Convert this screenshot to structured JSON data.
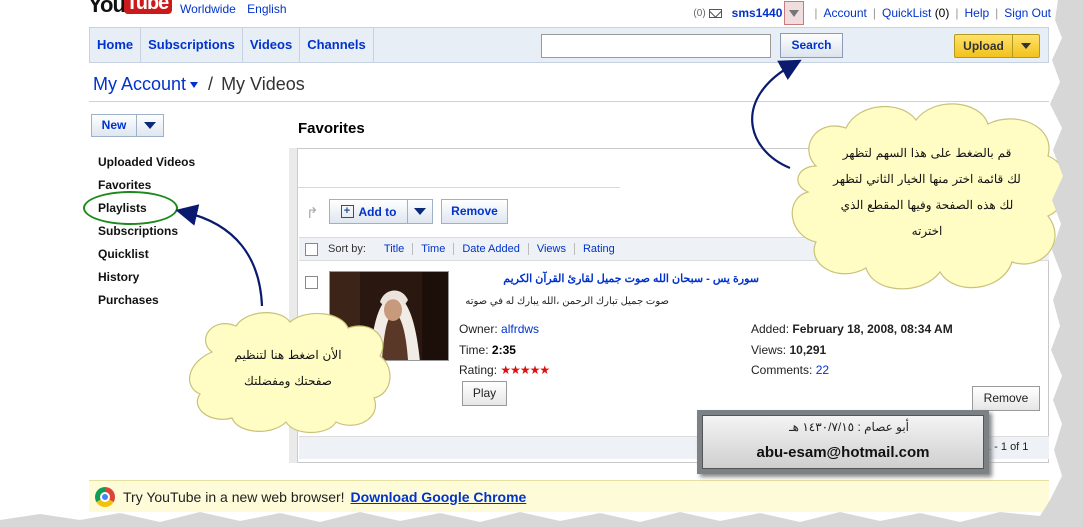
{
  "header": {
    "logo_you": "You",
    "logo_tube": "Tube",
    "region": "Worldwide",
    "language": "English",
    "mail_count": "(0)",
    "username": "sms1440",
    "account": "Account",
    "quicklist": "QuickList",
    "quicklist_count": "(0)",
    "help": "Help",
    "sign_out": "Sign Out"
  },
  "nav": {
    "tabs": [
      "Home",
      "Subscriptions",
      "Videos",
      "Channels"
    ],
    "search_value": "",
    "search_label": "Search",
    "upload_label": "Upload"
  },
  "breadcrumb": {
    "account": "My Account",
    "separator": "/",
    "current": "My Videos"
  },
  "new_button": "New",
  "sidebar": {
    "items": [
      "Uploaded Videos",
      "Favorites",
      "Playlists",
      "Subscriptions",
      "Quicklist",
      "History",
      "Purchases"
    ]
  },
  "main": {
    "title": "Favorites",
    "add_to_label": "Add to",
    "remove_label": "Remove",
    "sort_by": "Sort by:",
    "sort_options": [
      "Title",
      "Time",
      "Date Added",
      "Views",
      "Rating"
    ],
    "video": {
      "title": "سورة يس - سبحان الله صوت جميل لقارئ القرآن الكريم",
      "description": "صوت جميل تبارك الرحمن ،الله يبارك له في صوته",
      "owner_label": "Owner:",
      "owner": "alfrdws",
      "time_label": "Time:",
      "time": "2:35",
      "rating_label": "Rating:",
      "rating_stars": 5,
      "play_label": "Play",
      "added_label": "Added:",
      "added": "February 18, 2008, 08:34 AM",
      "views_label": "Views:",
      "views": "10,291",
      "comments_label": "Comments:",
      "comments": "22",
      "remove_label": "Remove"
    },
    "pager": "1 - 1 of 1"
  },
  "promo": {
    "text": "Try YouTube in a new web browser!",
    "link": "Download Google Chrome"
  },
  "annotations": {
    "cloud_right_lines": [
      "قم بالضغط على هذا السهم لتظهر",
      "لك قائمة اختر منها الخيار الثاني لتظهر",
      "لك هذه الصفحة وفيها المقطع الذي",
      "اخترته"
    ],
    "cloud_left_lines": [
      "الأن اضغط هنا لتنظيم",
      "صفحتك ومفضلتك"
    ],
    "signature_line1": "أبو عصام : ١٤٣٠/٧/١٥ هـ",
    "signature_line2": "abu-esam@hotmail.com"
  },
  "colors": {
    "link": "#0033cc",
    "upload": "#f2c21c",
    "circle": "#1e8a1e",
    "arrow": "#0a1a6e",
    "stars": "#dd1111"
  }
}
